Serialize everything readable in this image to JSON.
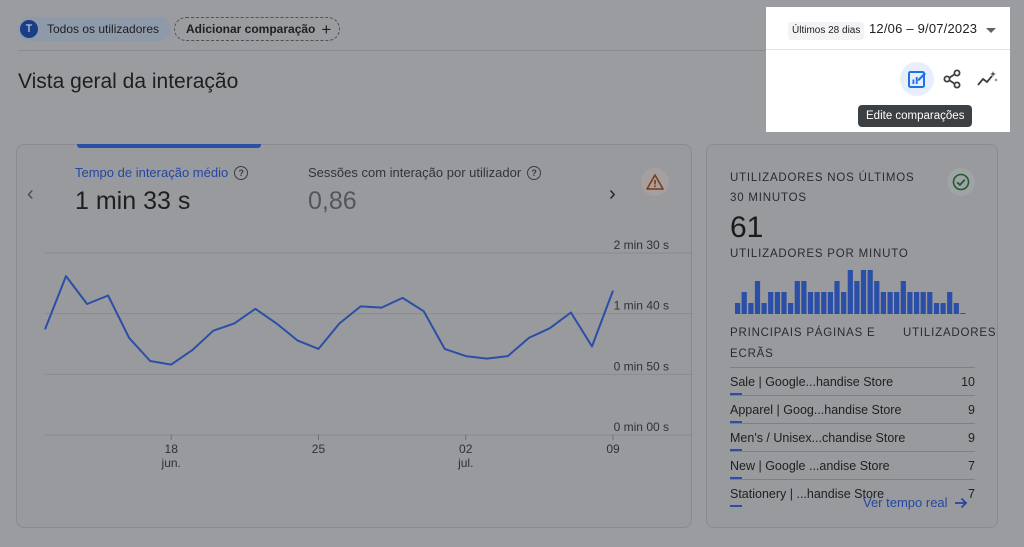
{
  "top_bar": {
    "user_chip": {
      "avatar_letter": "T",
      "label": "Todos os utilizadores"
    },
    "add_comparison": {
      "label": "Adicionar comparação",
      "icon": "plus-icon"
    }
  },
  "page_title": "Vista geral da interação",
  "date_picker": {
    "label": "Últimos 28 dias",
    "range": "12/06 – 9/07/2023",
    "icon": "caret-down-icon"
  },
  "toolbar": {
    "tools": [
      {
        "name": "edit-comparisons-button",
        "icon": "edit-comparisons-icon",
        "active": true
      },
      {
        "name": "share-button",
        "icon": "share-icon",
        "active": false
      },
      {
        "name": "insights-button",
        "icon": "insights-icon",
        "active": false
      }
    ],
    "tooltip": "Edite comparações"
  },
  "main_card": {
    "metrics": [
      {
        "label": "Tempo de interação médio",
        "value": "1 min 33 s",
        "active": true
      },
      {
        "label": "Sessões com interação por utilizador",
        "value": "0,86",
        "active": false
      }
    ],
    "nav_prev_icon": "chevron-left-icon",
    "nav_next_icon": "chevron-right-icon",
    "warning_icon": "warning-icon",
    "accent": "#2b4ea7"
  },
  "chart_data": {
    "type": "line",
    "series": [
      {
        "values": [
          87,
          131,
          108,
          115,
          80,
          61,
          58,
          70,
          86,
          92,
          104,
          92,
          78,
          71,
          92,
          106,
          105,
          113,
          102,
          71,
          65,
          63,
          65,
          80,
          88,
          101,
          73,
          119
        ]
      }
    ],
    "y_unit": "seconds",
    "ylim": [
      0,
      150
    ],
    "ytick_labels": [
      "0 min 00 s",
      "0 min 50 s",
      "1 min 40 s",
      "2 min 30 s"
    ],
    "x_ticks": [
      {
        "index": 6,
        "day": "18",
        "month": "jun."
      },
      {
        "index": 13,
        "day": "25",
        "month": ""
      },
      {
        "index": 20,
        "day": "02",
        "month": "jul."
      },
      {
        "index": 27,
        "day": "09",
        "month": ""
      }
    ],
    "x_start_date": "2023-06-12",
    "grid": true
  },
  "realtime": {
    "title": "UTILIZADORES NOS ÚLTIMOS 30 MINUTOS",
    "count": "61",
    "subtitle": "UTILIZADORES POR MINUTO",
    "per_minute": [
      1,
      2,
      1,
      3,
      1,
      2,
      2,
      2,
      1,
      3,
      3,
      2,
      2,
      2,
      2,
      3,
      2,
      4,
      3,
      4,
      4,
      3,
      2,
      2,
      2,
      3,
      2,
      2,
      2,
      2,
      1,
      1,
      2,
      1,
      0
    ],
    "check_icon": "check-circle-icon",
    "table_header": {
      "left": "PRINCIPAIS PÁGINAS E ECRÃS",
      "right": "UTILIZADORES"
    },
    "rows": [
      {
        "page": "Sale | Google...handise Store",
        "value": "10"
      },
      {
        "page": "Apparel | Goog...handise Store",
        "value": "9"
      },
      {
        "page": "Men's / Unisex...chandise Store",
        "value": "9"
      },
      {
        "page": "New | Google ...andise Store",
        "value": "7"
      },
      {
        "page": "Stationery | ...handise Store",
        "value": "7"
      }
    ],
    "link": {
      "label": "Ver tempo real",
      "icon": "arrow-right-icon"
    }
  }
}
